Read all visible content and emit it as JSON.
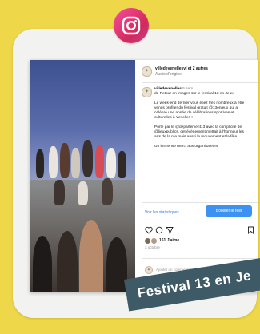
{
  "post": {
    "account": "villedevenellesvl",
    "account_suffix": "et 2 autres",
    "audio": "Audio d'origine",
    "caption_account": "villedevenelles",
    "caption_time": "5 sem",
    "caption_intro": "de Retour en images sur le festival 13 en Jeux",
    "caption_p1": "Le week-end dernier vous étiez très nombreux à être venus profiter du festival gratuit @13enjeux qui a célébré une année de célébrations sportives et culturelles à Venelles !",
    "caption_p2": "Porté par le @departement13 avec la complicité de @lieuxpublics, cet événement mettait à l'honneur les arts de la rue mais aussi le mouvement et la fête",
    "caption_p3": "Un immense merci aux organisateurs",
    "stats_link": "Voir les statistiques",
    "boost_button": "Booster le reel",
    "likes": "161 J'aime",
    "ago": "3 octobre",
    "comment_placeholder": "Ajouter un commentaire..."
  },
  "banner": {
    "text": "Festival 13 en Je"
  },
  "colors": {
    "background": "#eed84a",
    "banner": "#3e5a66",
    "boost": "#3c92f2"
  },
  "icons": [
    "instagram-icon",
    "heart-icon",
    "comment-icon",
    "share-icon",
    "bookmark-icon"
  ]
}
